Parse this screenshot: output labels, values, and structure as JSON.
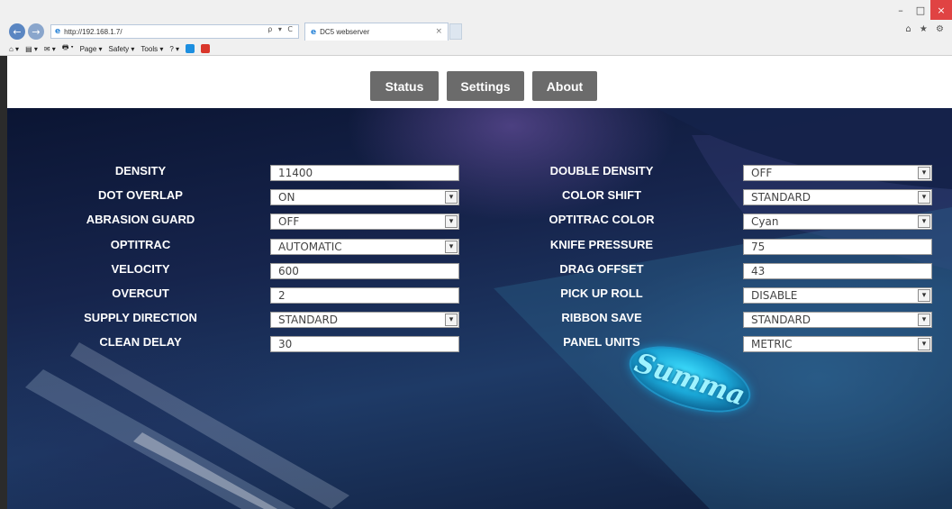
{
  "browser": {
    "address": "http://192.168.1.7/",
    "address_tools": "ρ ▾ C",
    "tab_title": "DC5 webserver",
    "tab_close": "×",
    "right_icons": "⌂ ★ ⚙",
    "window_controls": {
      "minimize": "–",
      "maximize": "□",
      "close": "×"
    },
    "back_arrow": "←",
    "forward_arrow": "→",
    "ie_icon": "e",
    "command_bar": {
      "home": "⌂ ▾",
      "feeds": "▤ ▾",
      "mail": "✉ ▾",
      "print": "🖶 ▾",
      "page": "Page ▾",
      "safety": "Safety ▾",
      "tools": "Tools ▾",
      "help": "? ▾",
      "colors": {
        "skype": "#1d8fe0",
        "ext": "#d9362b"
      }
    }
  },
  "nav": {
    "status": "Status",
    "settings": "Settings",
    "about": "About"
  },
  "settings_left": [
    {
      "label": "DENSITY",
      "type": "text",
      "value": "11400"
    },
    {
      "label": "DOT OVERLAP",
      "type": "select",
      "value": "ON"
    },
    {
      "label": "ABRASION GUARD",
      "type": "select",
      "value": "OFF"
    },
    {
      "label": "OPTITRAC",
      "type": "select",
      "value": "AUTOMATIC"
    },
    {
      "label": "VELOCITY",
      "type": "text",
      "value": "600"
    },
    {
      "label": "OVERCUT",
      "type": "text",
      "value": "2"
    },
    {
      "label": "SUPPLY DIRECTION",
      "type": "select",
      "value": "STANDARD"
    },
    {
      "label": "CLEAN DELAY",
      "type": "text",
      "value": "30"
    }
  ],
  "settings_right": [
    {
      "label": "DOUBLE DENSITY",
      "type": "select",
      "value": "OFF"
    },
    {
      "label": "COLOR SHIFT",
      "type": "select",
      "value": "STANDARD"
    },
    {
      "label": "OPTITRAC COLOR",
      "type": "select",
      "value": "Cyan"
    },
    {
      "label": "KNIFE PRESSURE",
      "type": "text",
      "value": "75"
    },
    {
      "label": "DRAG OFFSET",
      "type": "text",
      "value": "43"
    },
    {
      "label": "PICK UP ROLL",
      "type": "select",
      "value": "DISABLE"
    },
    {
      "label": "RIBBON SAVE",
      "type": "select",
      "value": "STANDARD"
    },
    {
      "label": "PANEL UNITS",
      "type": "select",
      "value": "METRIC"
    }
  ],
  "select_arrow": "▾",
  "logo": {
    "text": "Summa"
  },
  "colors": {
    "nav_button": "#6b6b6b",
    "logo_glow": "#3fe0ff",
    "hero_dark": "#0b1533"
  }
}
